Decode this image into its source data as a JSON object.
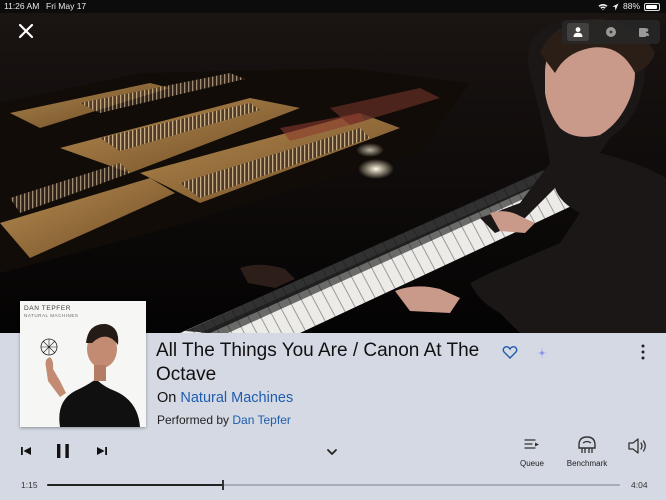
{
  "status_bar": {
    "time": "11:26 AM",
    "date": "Fri May 17",
    "battery": "88%",
    "battery_level": 0.88
  },
  "hero": {
    "alt_icon": "close-icon",
    "view_icons": [
      "person-icon",
      "disc-icon",
      "credits-icon"
    ]
  },
  "album_cover": {
    "artist_text": "DAN TEPFER",
    "album_text": "NATURAL MACHINES"
  },
  "track": {
    "title": "All The Things You Are / Canon At The Octave",
    "album_prefix": "On",
    "album": "Natural Machines",
    "performer_prefix": "Performed by",
    "performer": "Dan Tepfer"
  },
  "controls": {
    "queue_label": "Queue",
    "benchmark_label": "Benchmark"
  },
  "progress": {
    "elapsed": "1:15",
    "total": "4:04",
    "fraction": 0.307
  },
  "colors": {
    "accent": "#1f5cae",
    "panel": "#d4d9e3"
  }
}
